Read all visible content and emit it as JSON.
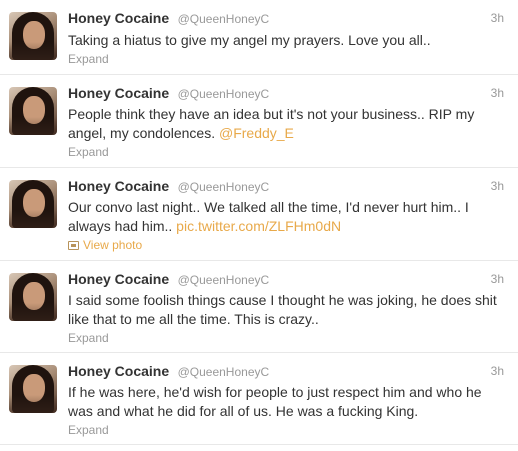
{
  "tweets": [
    {
      "name": "Honey Cocaine",
      "handle": "@QueenHoneyC",
      "time": "3h",
      "text": "Taking a hiatus to give my angel my prayers. Love you all..",
      "link": "",
      "action": "Expand",
      "action_icon": ""
    },
    {
      "name": "Honey Cocaine",
      "handle": "@QueenHoneyC",
      "time": "3h",
      "text": "People think they have an idea but it's not your business.. RIP my angel, my condolences.",
      "link": "@Freddy_E",
      "action": "Expand",
      "action_icon": ""
    },
    {
      "name": "Honey Cocaine",
      "handle": "@QueenHoneyC",
      "time": "3h",
      "text": "Our convo last night.. We talked all the time, I'd never hurt him.. I always had him..",
      "link": "pic.twitter.com/ZLFHm0dN",
      "action": "View photo",
      "action_icon": "photo-icon"
    },
    {
      "name": "Honey Cocaine",
      "handle": "@QueenHoneyC",
      "time": "3h",
      "text": "I said some foolish things cause I thought he was joking, he does shit like that to me all the time. This is crazy..",
      "link": "",
      "action": "Expand",
      "action_icon": ""
    },
    {
      "name": "Honey Cocaine",
      "handle": "@QueenHoneyC",
      "time": "3h",
      "text": "If he was here, he'd wish for people to just respect him and who he was and what he did for all of us. He was a fucking King.",
      "link": "",
      "action": "Expand",
      "action_icon": ""
    }
  ],
  "colors": {
    "link": "#e8a94a",
    "muted": "#999999",
    "text": "#333333",
    "divider": "#e8e8e8"
  }
}
